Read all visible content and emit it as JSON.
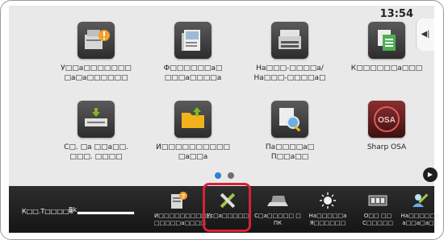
{
  "status": {
    "time": "13:54",
    "side_tab": "◀|"
  },
  "apps": [
    {
      "id": "app-1",
      "label_line1": "У□□а□□□□□□□",
      "label_line2": "□а□а□□□□□□",
      "icon": "settings-user-icon",
      "accent": "#f1a22b"
    },
    {
      "id": "app-2",
      "label_line1": "Ф□□□□□□а□",
      "label_line2": "□□□а□□□□а",
      "icon": "document-stack-icon",
      "accent": "#9fb8d8"
    },
    {
      "id": "app-3",
      "label_line1": "На□□□-□□□□а/",
      "label_line2": "На□□□-□□□□а□",
      "icon": "copier-icon",
      "accent": "#dddddd"
    },
    {
      "id": "app-4",
      "label_line1": "К□□□□□□а□□□",
      "label_line2": "",
      "icon": "copy-icon",
      "accent": "#4caf50"
    },
    {
      "id": "app-5",
      "label_line1": "С□. □а □□а□□.",
      "label_line2": "□□□. □□□□",
      "icon": "scan-tray-icon",
      "accent": "#7fb81f"
    },
    {
      "id": "app-6",
      "label_line1": "И□□□□□□□□□□",
      "label_line2": "□а□□а",
      "icon": "folder-upload-icon",
      "accent": "#f2b21b"
    },
    {
      "id": "app-7",
      "label_line1": "Па□□□□а□",
      "label_line2": "П□□а□□",
      "icon": "magnifier-document-icon",
      "accent": "#6ab0e8"
    },
    {
      "id": "app-8",
      "label_line1": "Sharp OSA",
      "label_line2": "",
      "icon": "osa-icon",
      "accent": "#cc2f3c"
    }
  ],
  "page_dots": {
    "active_color": "#2e7fd1",
    "inactive_color": "#6f6f6f"
  },
  "next_button": "▶",
  "toner": {
    "label": "К□□.Т□□□□а",
    "letter": "Bk",
    "level_percent": 100
  },
  "shortcuts": [
    {
      "id": "sc-1",
      "label_line1": "И□□□□□□□□□□",
      "label_line2": "□□□□□а□□□□",
      "icon": "document-question-icon"
    },
    {
      "id": "sc-2",
      "label_line1": "Ус□а□□□□□",
      "label_line2": "",
      "icon": "tools-icon"
    },
    {
      "id": "sc-3",
      "label_line1": "С□а□□□□□ □",
      "label_line2": "ПК",
      "icon": "laptop-icon"
    },
    {
      "id": "sc-4",
      "label_line1": "На□□□□□а",
      "label_line2": "Я□□□□□□",
      "icon": "brightness-icon"
    },
    {
      "id": "sc-5",
      "label_line1": "О□□ □□",
      "label_line2": "С□□□□□",
      "icon": "counter-icon"
    },
    {
      "id": "sc-6",
      "label_line1": "На□□□□□а",
      "label_line2": "а□□а□а□а",
      "icon": "user-settings-icon"
    }
  ],
  "colors": {
    "highlight": "#d8203a"
  }
}
